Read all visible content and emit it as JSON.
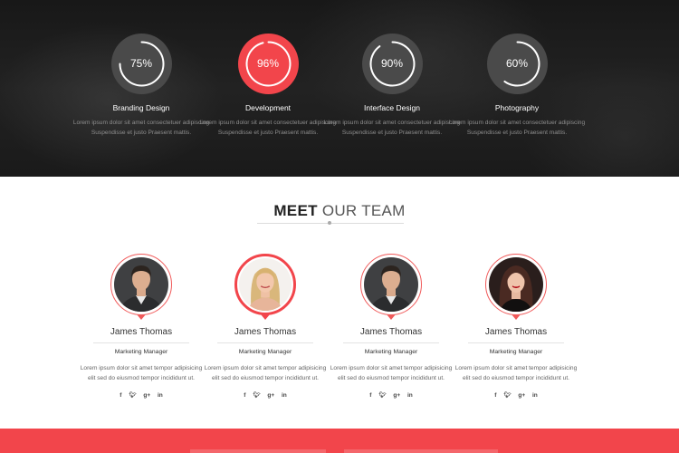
{
  "skills": [
    {
      "percent": 75,
      "label": "75%",
      "title": "Branding Design",
      "desc": "Lorem ipsum dolor sit amet consectetuer adipiscing  Suspendisse et justo Praesent mattis."
    },
    {
      "percent": 96,
      "label": "96%",
      "title": "Development",
      "desc": "Lorem ipsum dolor sit amet consectetuer adipiscing  Suspendisse et justo Praesent mattis."
    },
    {
      "percent": 90,
      "label": "90%",
      "title": "Interface Design",
      "desc": "Lorem ipsum dolor sit amet consectetuer adipiscing  Suspendisse et justo Praesent mattis."
    },
    {
      "percent": 60,
      "label": "60%",
      "title": "Photography",
      "desc": "Lorem ipsum dolor sit amet consectetuer adipiscing  Suspendisse et justo Praesent mattis."
    }
  ],
  "team": {
    "heading_bold": "MEET",
    "heading_light": "OUR TEAM",
    "members": [
      {
        "name": "James Thomas",
        "role": "Marketing Manager",
        "desc": "Lorem ipsum dolor sit amet tempor adipisicing elit sed do eiusmod tempor incididunt ut.",
        "socials": [
          "f",
          "t",
          "g+",
          "in"
        ]
      },
      {
        "name": "James Thomas",
        "role": "Marketing Manager",
        "desc": "Lorem ipsum dolor sit amet tempor adipisicing elit sed do eiusmod tempor incididunt ut.",
        "socials": [
          "f",
          "t",
          "g+",
          "in"
        ]
      },
      {
        "name": "James Thomas",
        "role": "Marketing Manager",
        "desc": "Lorem ipsum dolor sit amet tempor adipisicing elit sed do eiusmod tempor incididunt ut.",
        "socials": [
          "f",
          "t",
          "g+",
          "in"
        ]
      },
      {
        "name": "James Thomas",
        "role": "Marketing Manager",
        "desc": "Lorem ipsum dolor sit amet tempor adipisicing elit sed do eiusmod tempor incididunt ut.",
        "socials": [
          "f",
          "t",
          "g+",
          "in"
        ]
      }
    ]
  },
  "colors": {
    "accent": "#f2454b",
    "dark_bg": "#1c1c1c",
    "ring_bg": "#4a4a4a"
  }
}
